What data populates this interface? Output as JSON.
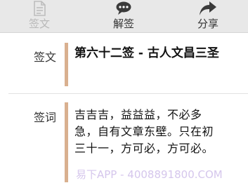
{
  "toolbar": {
    "items": [
      {
        "label": "签文",
        "icon": "document-icon",
        "enabled": false
      },
      {
        "label": "解签",
        "icon": "chat-bubble-icon",
        "enabled": true
      },
      {
        "label": "分享",
        "icon": "share-arrow-icon",
        "enabled": true
      }
    ]
  },
  "content": {
    "title_label": "签文",
    "title_value": "第六十二签 - 古人文昌三圣",
    "poem_label": "签词",
    "poem_value": "吉吉吉，益益益，不必多急，自有文章东壁。只在初三十一，方可必，方可必。"
  },
  "watermark": "易下APP - 4008891800.COM",
  "colors": {
    "accent_bar": "#d9b08f",
    "toolbar_bg": "#e8e8e8"
  }
}
